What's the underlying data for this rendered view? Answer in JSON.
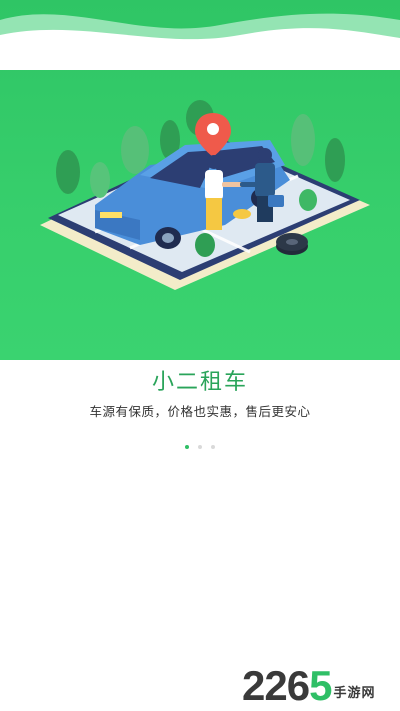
{
  "colors": {
    "hero_green": "#33cb6a",
    "title_green": "#2aa45a",
    "dot_active": "#2fbf66",
    "dot_inactive": "#d9d9d9"
  },
  "illustration": {
    "description_icon": "car-rental-illustration",
    "icons": [
      "location-pin-icon",
      "car-icon",
      "tire-icon",
      "briefcase-icon"
    ]
  },
  "intro": {
    "title": "小二租车",
    "subtitle": "车源有保质，价格也实惠，售后更安心"
  },
  "pager": {
    "total": 3,
    "active_index": 0
  },
  "watermark": {
    "number_part1": "226",
    "number_part2": "5",
    "cn_text": "手游网"
  }
}
